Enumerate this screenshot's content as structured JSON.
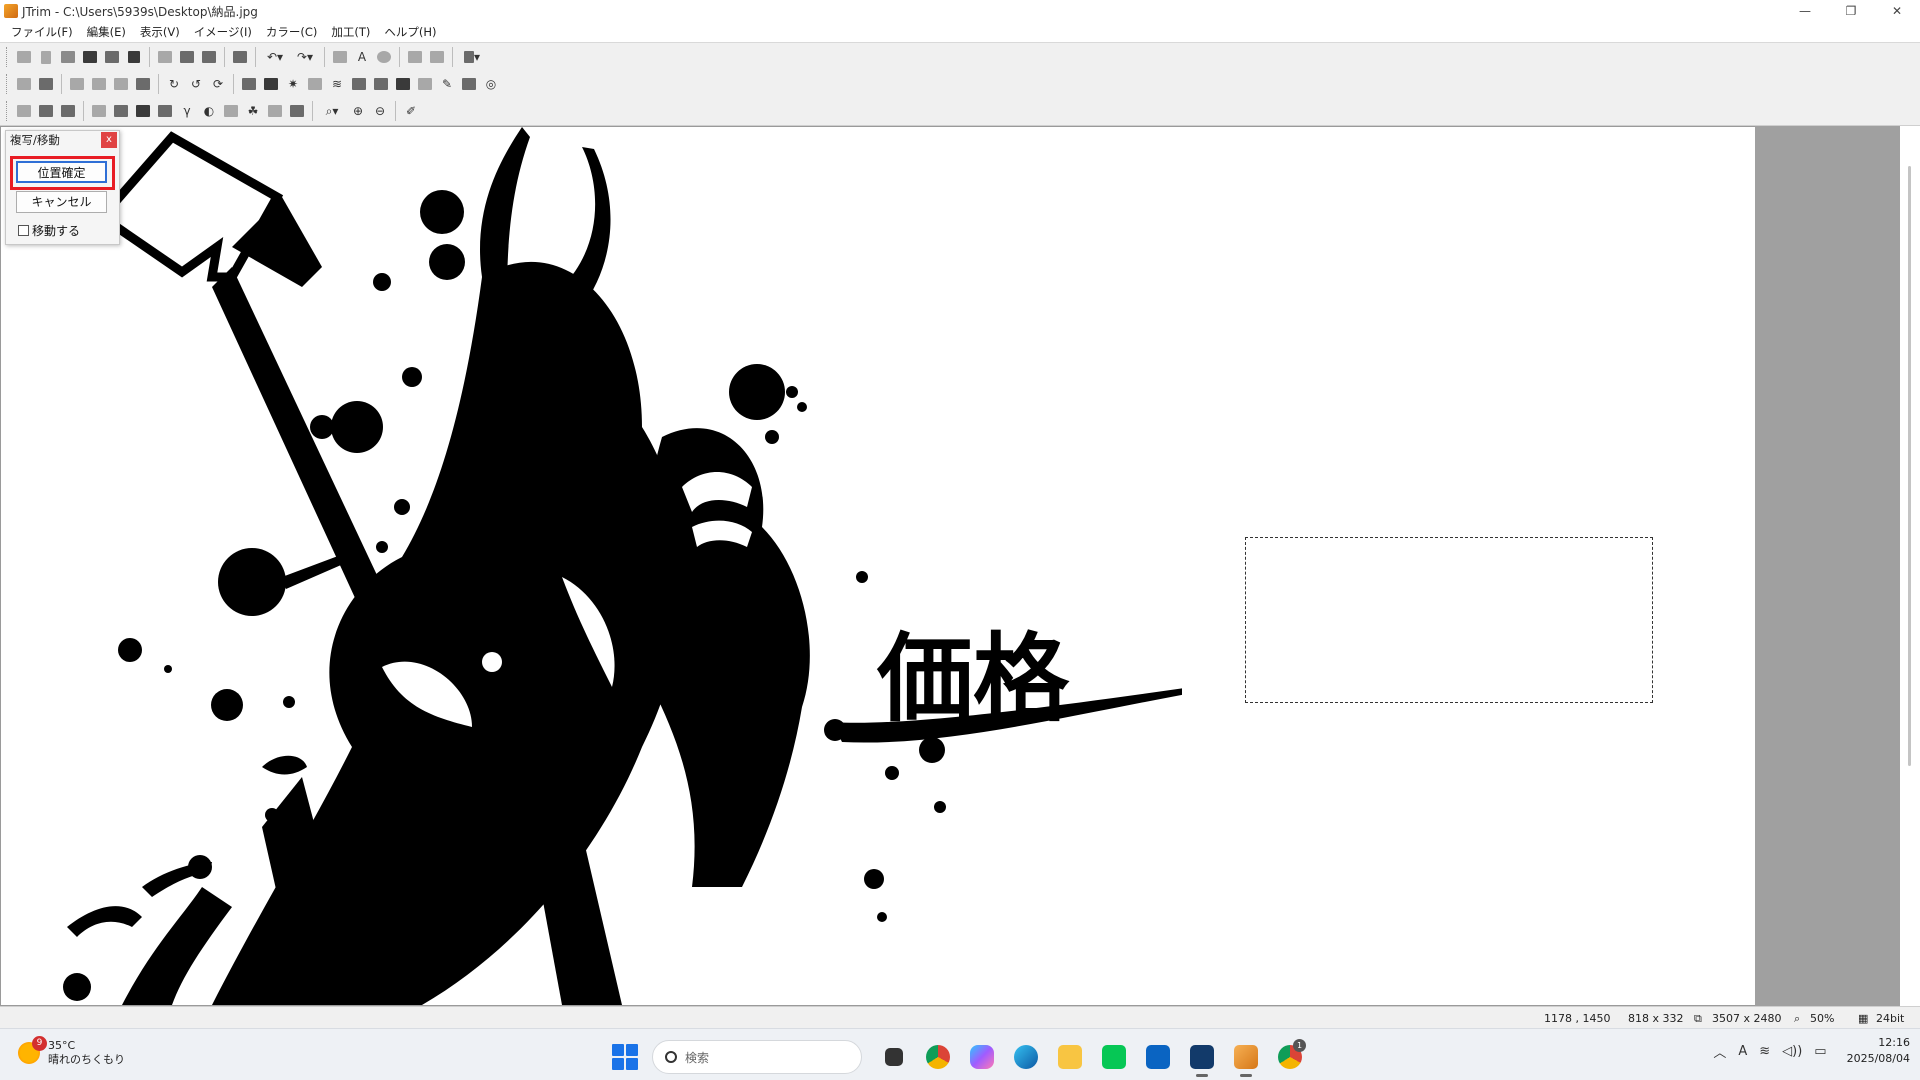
{
  "window": {
    "title": "JTrim - C:\\Users\\5939s\\Desktop\\納品.jpg",
    "controls": [
      "—",
      "❐",
      "✕"
    ]
  },
  "menu": [
    "ファイル(F)",
    "編集(E)",
    "表示(V)",
    "イメージ(I)",
    "カラー(C)",
    "加工(T)",
    "ヘルプ(H)"
  ],
  "dialog": {
    "title": "複写/移動",
    "close": "x",
    "confirm_label": "位置確定",
    "cancel_label": "キャンセル",
    "move_label": "移動する",
    "move_checked": false
  },
  "canvas": {
    "art_text": "価格"
  },
  "status": {
    "cursor": "1178 , 1450",
    "selection_size": "818 x 332",
    "image_size": "3507 x 2480",
    "zoom": "50%",
    "depth": "24bit"
  },
  "taskbar": {
    "weather_badge": "9",
    "temperature": "35°C",
    "weather": "晴れのちくもり",
    "search_placeholder": "検索",
    "time": "12:16",
    "date": "2025/08/04",
    "ime": "A",
    "chrome_badge": "1"
  }
}
